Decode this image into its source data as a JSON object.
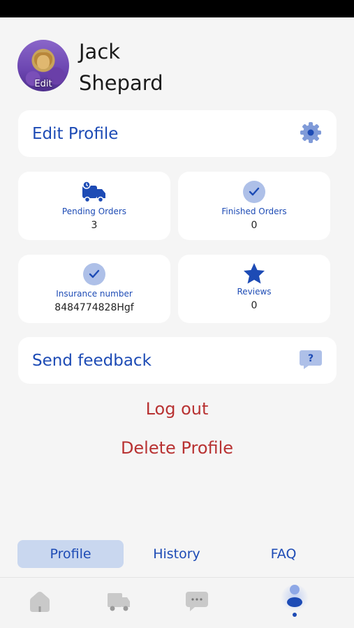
{
  "profile": {
    "first_name": "Jack",
    "last_name": "Shepard",
    "avatar_edit_label": "Edit"
  },
  "edit_profile": {
    "label": "Edit Profile",
    "icon": "gear-icon"
  },
  "stats": [
    {
      "title": "Pending Orders",
      "value": "3",
      "icon": "delivery-truck-icon"
    },
    {
      "title": "Finished Orders",
      "value": "0",
      "icon": "checkmark-circle-icon"
    },
    {
      "title": "Insurance number",
      "value": "8484774828Hgf",
      "icon": "checkmark-circle-icon"
    },
    {
      "title": "Reviews",
      "value": "0",
      "icon": "star-icon"
    }
  ],
  "feedback": {
    "label": "Send feedback",
    "icon": "help-chat-icon"
  },
  "actions": {
    "logout": "Log out",
    "delete": "Delete Profile"
  },
  "tabs": [
    {
      "label": "Profile",
      "active": true
    },
    {
      "label": "History",
      "active": false
    },
    {
      "label": "FAQ",
      "active": false
    }
  ],
  "bottom_nav": [
    {
      "icon": "home-icon",
      "active": false
    },
    {
      "icon": "truck-icon",
      "active": false
    },
    {
      "icon": "chat-icon",
      "active": false
    },
    {
      "icon": "person-icon",
      "active": true
    }
  ],
  "colors": {
    "accent": "#1d4bb5",
    "danger": "#b83232",
    "accent_soft": "#aec0e8",
    "tab_active_bg": "#c9d7ef"
  }
}
